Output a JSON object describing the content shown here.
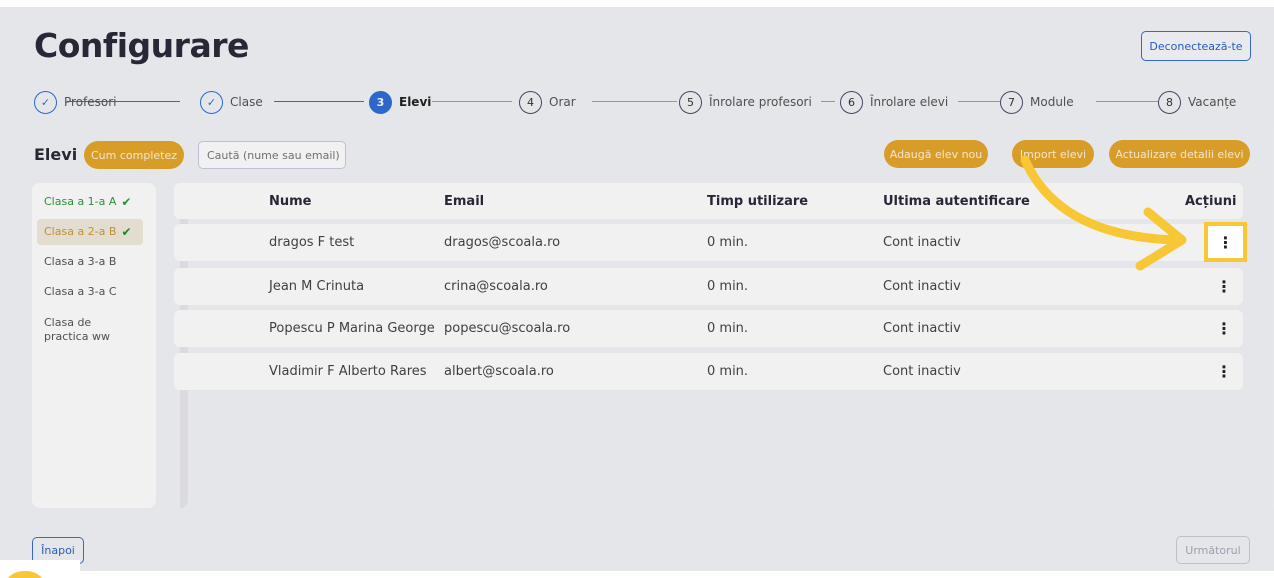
{
  "page": {
    "title": "Configurare",
    "logout_label": "Deconectează-te"
  },
  "stepper": {
    "steps": [
      {
        "number": "",
        "label": "Profesori",
        "state": "done"
      },
      {
        "number": "",
        "label": "Clase",
        "state": "done"
      },
      {
        "number": "3",
        "label": "Elevi",
        "state": "active"
      },
      {
        "number": "4",
        "label": "Orar",
        "state": "todo"
      },
      {
        "number": "5",
        "label": "Înrolare profesori",
        "state": "todo"
      },
      {
        "number": "6",
        "label": "Înrolare elevi",
        "state": "todo"
      },
      {
        "number": "7",
        "label": "Module",
        "state": "todo"
      },
      {
        "number": "8",
        "label": "Vacanțe",
        "state": "todo"
      }
    ],
    "check_glyph": "✓"
  },
  "toolbar": {
    "section_title": "Elevi",
    "howto_label": "Cum completez",
    "search_placeholder": "Caută (nume sau email)",
    "add_label": "Adaugă elev nou",
    "import_label": "Import elevi",
    "update_label": "Actualizare detalii elevi"
  },
  "sidebar": {
    "items": [
      {
        "label": "Clasa a 1-a A",
        "checked": true,
        "selected": false
      },
      {
        "label": "Clasa a 2-a B",
        "checked": true,
        "selected": true
      },
      {
        "label": "Clasa a 3-a B",
        "checked": false,
        "selected": false
      },
      {
        "label": "Clasa a 3-a C",
        "checked": false,
        "selected": false
      },
      {
        "label": "Clasa de practica ww",
        "checked": false,
        "selected": false
      }
    ],
    "check_glyph": "✔"
  },
  "table": {
    "headers": {
      "name": "Nume",
      "email": "Email",
      "time": "Timp utilizare",
      "last_login": "Ultima autentificare",
      "actions": "Acțiuni"
    },
    "rows": [
      {
        "name": "dragos F test",
        "email": "dragos@scoala.ro",
        "time": "0 min.",
        "last_login": "Cont inactiv"
      },
      {
        "name": "Jean M Crinuta",
        "email": "crina@scoala.ro",
        "time": "0 min.",
        "last_login": "Cont inactiv"
      },
      {
        "name": "Popescu P Marina George",
        "email": "popescu@scoala.ro",
        "time": "0 min.",
        "last_login": "Cont inactiv"
      },
      {
        "name": "Vladimir F Alberto Rares",
        "email": "albert@scoala.ro",
        "time": "0 min.",
        "last_login": "Cont inactiv"
      }
    ],
    "kebab_glyph": "⋮"
  },
  "footer": {
    "back_label": "Înapoi",
    "next_label": "Următorul"
  },
  "colors": {
    "accent_blue": "#2f6ed8",
    "accent_orange": "#e5a72c",
    "highlight_yellow": "#f7c735",
    "success_green": "#2e9a3a"
  },
  "icons": {
    "step_done": "check-icon",
    "row_actions": "kebab-menu-icon",
    "annotation": "curved-arrow-icon"
  }
}
